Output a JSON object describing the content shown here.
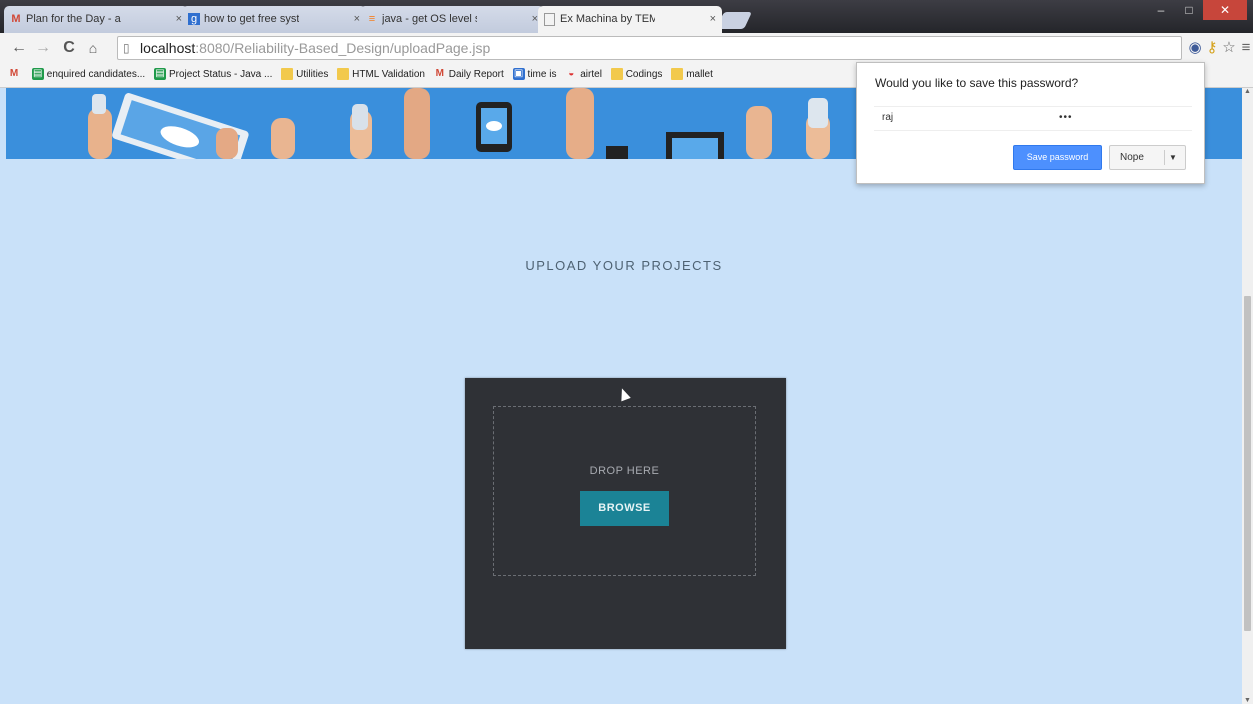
{
  "browser": {
    "tabs": [
      {
        "title": "Plan for the Day - arumpri",
        "icon": "gmail-icon",
        "active": false
      },
      {
        "title": "how to get free system",
        "icon": "google-icon",
        "active": false
      },
      {
        "title": "java - get OS level system",
        "icon": "stackoverflow-icon",
        "active": false
      },
      {
        "title": "Ex Machina by TEMPLATE",
        "icon": "page-icon",
        "active": true
      }
    ],
    "url_host": "localhost",
    "url_rest": ":8080/Reliability-Based_Design/uploadPage.jsp",
    "bookmarks": [
      {
        "label": "enquired candidates...",
        "icon": "green"
      },
      {
        "label": "Project Status - Java ...",
        "icon": "green"
      },
      {
        "label": "Utilities",
        "icon": "folder"
      },
      {
        "label": "HTML Validation",
        "icon": "folder"
      },
      {
        "label": "Daily Report",
        "icon": "gmail"
      },
      {
        "label": "time is",
        "icon": "blue"
      },
      {
        "label": "airtel",
        "icon": "red"
      },
      {
        "label": "Codings",
        "icon": "folder"
      },
      {
        "label": "mallet",
        "icon": "folder"
      }
    ]
  },
  "page": {
    "heading": "UPLOAD YOUR PROJECTS",
    "upload": {
      "drop_label": "DROP HERE",
      "browse_label": "BROWSE"
    }
  },
  "password_prompt": {
    "title": "Would you like to save this password?",
    "username": "raj",
    "password_mask": "•••",
    "save_label": "Save password",
    "nope_label": "Nope"
  },
  "colors": {
    "page_bg": "#c9e1f9",
    "banner_bg": "#3a8fdc",
    "upload_box_bg": "#2f3136",
    "browse_button": "#1b8396",
    "save_button": "#4d90fe"
  }
}
